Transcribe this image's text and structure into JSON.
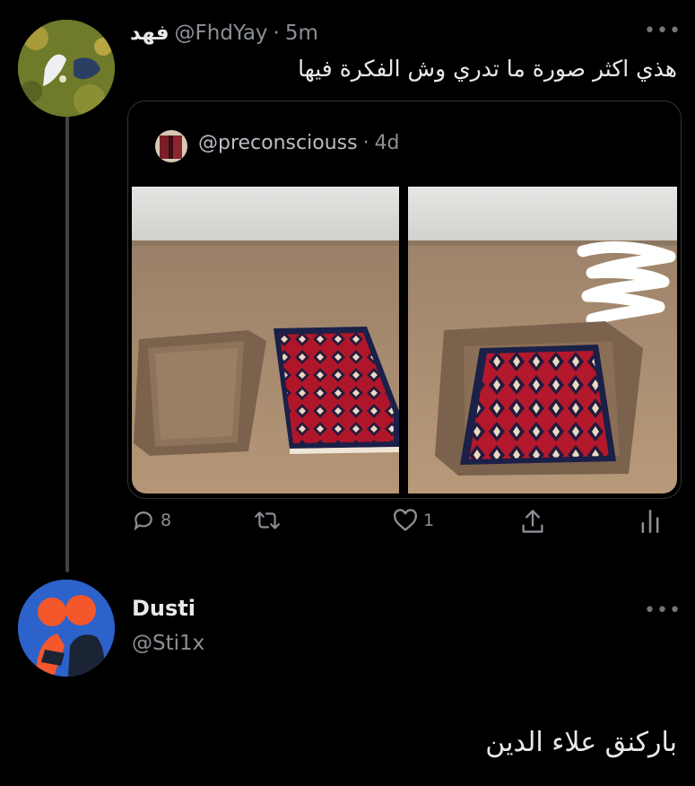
{
  "tweet": {
    "author_name": "فهد",
    "handle": "@FhdYay",
    "separator": "·",
    "time": "5m",
    "text": "هذي اكثر صورة ما تدري وش الفكرة فيها",
    "quoted": {
      "handle": "@preconsciouss",
      "separator": "·",
      "time": "4d"
    },
    "actions": {
      "reply_count": "8",
      "like_count": "1"
    }
  },
  "reply": {
    "author_name": "Dusti",
    "handle": "@Sti1x",
    "text": "باركنق علاء الدين"
  },
  "colors": {
    "background": "#000000",
    "text": "#e7e9ea",
    "muted": "#8b9096",
    "rug_red": "#b0162a",
    "sand": "#a8896a"
  }
}
